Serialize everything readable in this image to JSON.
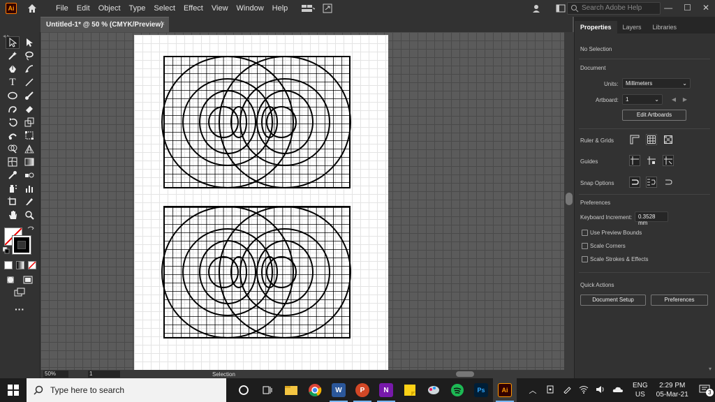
{
  "app": {
    "logo_text": "Ai"
  },
  "menu": {
    "items": [
      "File",
      "Edit",
      "Object",
      "Type",
      "Select",
      "Effect",
      "View",
      "Window",
      "Help"
    ]
  },
  "search": {
    "placeholder": "Search Adobe Help"
  },
  "window_controls": [
    "—",
    "☐",
    "✕"
  ],
  "document_tab": {
    "title": "Untitled-1* @ 50 % (CMYK/Preview)",
    "close": "×"
  },
  "statusbar": {
    "zoom": "50%",
    "artboard_num": "1",
    "tool_mode": "Selection"
  },
  "panel": {
    "tabs": [
      "Properties",
      "Layers",
      "Libraries"
    ],
    "selection_text": "No Selection",
    "document_heading": "Document",
    "units_label": "Units:",
    "units_value": "Millimeters",
    "artboard_label": "Artboard:",
    "artboard_value": "1",
    "edit_artboards": "Edit Artboards",
    "ruler_grids": "Ruler & Grids",
    "guides": "Guides",
    "snap_options": "Snap Options",
    "preferences_heading": "Preferences",
    "keyboard_increment_label": "Keyboard Increment:",
    "keyboard_increment_value": "0.3528 mm",
    "checkboxes": [
      "Use Preview Bounds",
      "Scale Corners",
      "Scale Strokes & Effects"
    ],
    "quick_actions_heading": "Quick Actions",
    "document_setup": "Document Setup",
    "preferences_button": "Preferences"
  },
  "taskbar": {
    "search_placeholder": "Type here to search",
    "apps": [
      "file-explorer",
      "chrome",
      "word",
      "powerpoint",
      "onenote",
      "sticky-notes",
      "paint-3d",
      "spotify",
      "photoshop",
      "illustrator"
    ],
    "lang_top": "ENG",
    "lang_bottom": "US",
    "time": "2:29 PM",
    "date": "05-Mar-21",
    "notification_count": "3"
  },
  "colors": {
    "accent": "#ff9a00",
    "ui_dark": "#323232",
    "canvas": "#535353"
  }
}
